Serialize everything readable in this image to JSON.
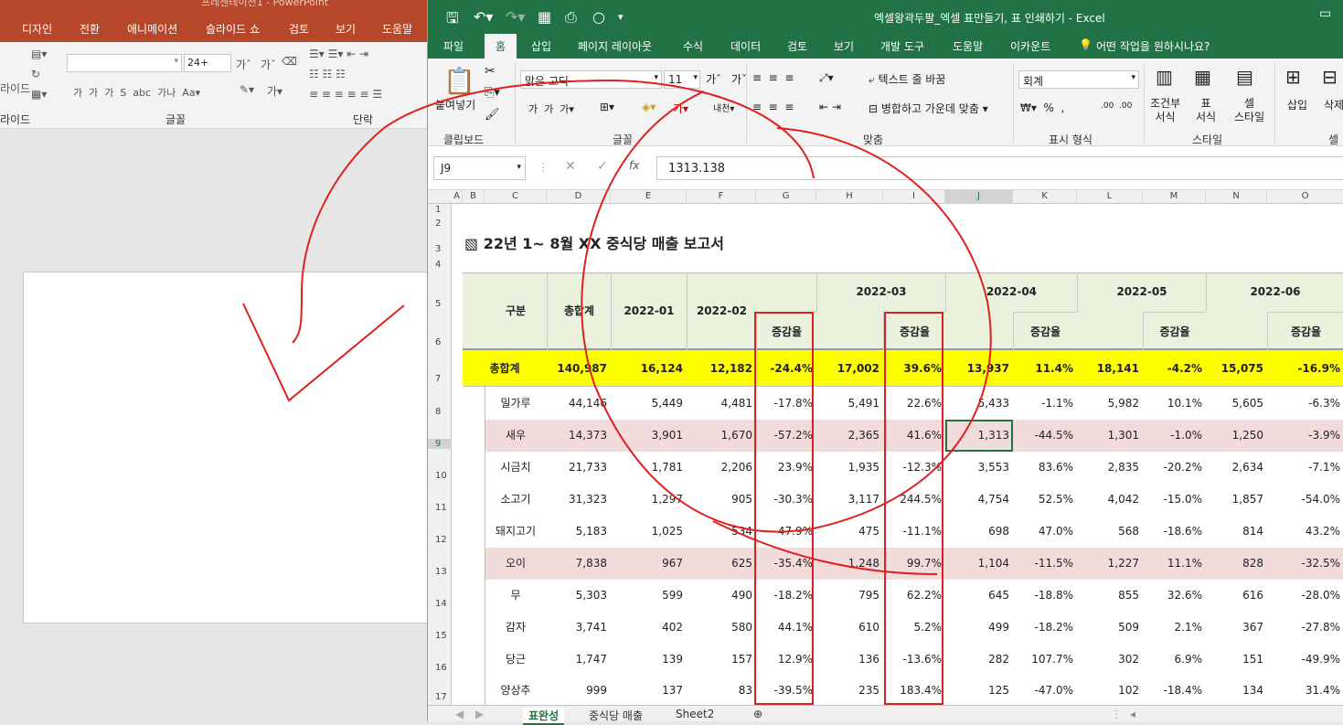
{
  "ppt": {
    "title": "프레젠테이션1 - PowerPoint",
    "tabs": [
      "디자인",
      "전환",
      "애니메이션",
      "슬라이드 쇼",
      "검토",
      "보기",
      "도움말"
    ],
    "font_size": "24+",
    "groups": {
      "slides": "라이드",
      "font": "글꼴",
      "paragraph": "단락"
    },
    "slide_label": "라이드"
  },
  "excel": {
    "doc_title": "엑셀왕곽두팔_엑셀 표만들기, 표 인쇄하기  -  Excel",
    "tabs": [
      "파일",
      "홈",
      "삽입",
      "페이지 레이아웃",
      "수식",
      "데이터",
      "검토",
      "보기",
      "개발 도구",
      "도움말",
      "이카운트",
      "어떤 작업을 원하시나요?"
    ],
    "ribbon": {
      "paste": "붙여넣기",
      "clipboard": "클립보드",
      "font_name": "맑은 고딕",
      "font_size": "11",
      "font": "글꼴",
      "wrap": "텍스트 줄 바꿈",
      "merge": "병합하고 가운데 맞춤",
      "align": "맞춤",
      "number_format": "회계",
      "number": "표시 형식",
      "cond": "조건부\n서식",
      "table": "표\n서식",
      "cellstyle": "셀\n스타일",
      "style": "스타일",
      "insert": "삽입",
      "delete": "삭제",
      "cells": "셀"
    },
    "name_box": "J9",
    "formula": "1313.138",
    "columns": [
      "A",
      "B",
      "C",
      "D",
      "E",
      "F",
      "G",
      "H",
      "I",
      "J",
      "K",
      "L",
      "M",
      "N",
      "O"
    ],
    "sheet_title": "22년 1~ 8월 XX 중식당 매출 보고서",
    "header": {
      "category": "구분",
      "total": "총합계",
      "months": [
        "2022-01",
        "2022-02",
        "2022-03",
        "2022-04",
        "2022-05",
        "2022-06"
      ],
      "change": "증감율"
    },
    "total_row": {
      "label": "총합계",
      "values": [
        "140,987",
        "16,124",
        "12,182",
        "-24.4%",
        "17,002",
        "39.6%",
        "13,937",
        "11.4%",
        "18,141",
        "-4.2%",
        "15,075",
        "-16.9%"
      ]
    },
    "rows": [
      {
        "label": "밀가루",
        "values": [
          "44,146",
          "5,449",
          "4,481",
          "-17.8%",
          "5,491",
          "22.6%",
          "5,433",
          "-1.1%",
          "5,982",
          "10.1%",
          "5,605",
          "-6.3%"
        ]
      },
      {
        "label": "새우",
        "values": [
          "14,373",
          "3,901",
          "1,670",
          "-57.2%",
          "2,365",
          "41.6%",
          "1,313",
          "-44.5%",
          "1,301",
          "-1.0%",
          "1,250",
          "-3.9%"
        ]
      },
      {
        "label": "시금치",
        "values": [
          "21,733",
          "1,781",
          "2,206",
          "23.9%",
          "1,935",
          "-12.3%",
          "3,553",
          "83.6%",
          "2,835",
          "-20.2%",
          "2,634",
          "-7.1%"
        ]
      },
      {
        "label": "소고기",
        "values": [
          "31,323",
          "1,297",
          "905",
          "-30.3%",
          "3,117",
          "244.5%",
          "4,754",
          "52.5%",
          "4,042",
          "-15.0%",
          "1,857",
          "-54.0%"
        ]
      },
      {
        "label": "돼지고기",
        "values": [
          "5,183",
          "1,025",
          "534",
          "-47.9%",
          "475",
          "-11.1%",
          "698",
          "47.0%",
          "568",
          "-18.6%",
          "814",
          "43.2%"
        ]
      },
      {
        "label": "오이",
        "values": [
          "7,838",
          "967",
          "625",
          "-35.4%",
          "1,248",
          "99.7%",
          "1,104",
          "-11.5%",
          "1,227",
          "11.1%",
          "828",
          "-32.5%"
        ]
      },
      {
        "label": "무",
        "values": [
          "5,303",
          "599",
          "490",
          "-18.2%",
          "795",
          "62.2%",
          "645",
          "-18.8%",
          "855",
          "32.6%",
          "616",
          "-28.0%"
        ]
      },
      {
        "label": "감자",
        "values": [
          "3,741",
          "402",
          "580",
          "44.1%",
          "610",
          "5.2%",
          "499",
          "-18.2%",
          "509",
          "2.1%",
          "367",
          "-27.8%"
        ]
      },
      {
        "label": "당근",
        "values": [
          "1,747",
          "139",
          "157",
          "12.9%",
          "136",
          "-13.6%",
          "282",
          "107.7%",
          "302",
          "6.9%",
          "151",
          "-49.9%"
        ]
      },
      {
        "label": "양상추",
        "values": [
          "999",
          "137",
          "83",
          "-39.5%",
          "235",
          "183.4%",
          "125",
          "-47.0%",
          "102",
          "-18.4%",
          "134",
          "31.4%"
        ]
      }
    ],
    "sheets": [
      "표완성",
      "중식당 매출",
      "Sheet2"
    ],
    "colors": {
      "green": "#217346",
      "yellow": "#ffff00",
      "pink": "#f2dcdb",
      "annotation": "#e02020"
    }
  }
}
